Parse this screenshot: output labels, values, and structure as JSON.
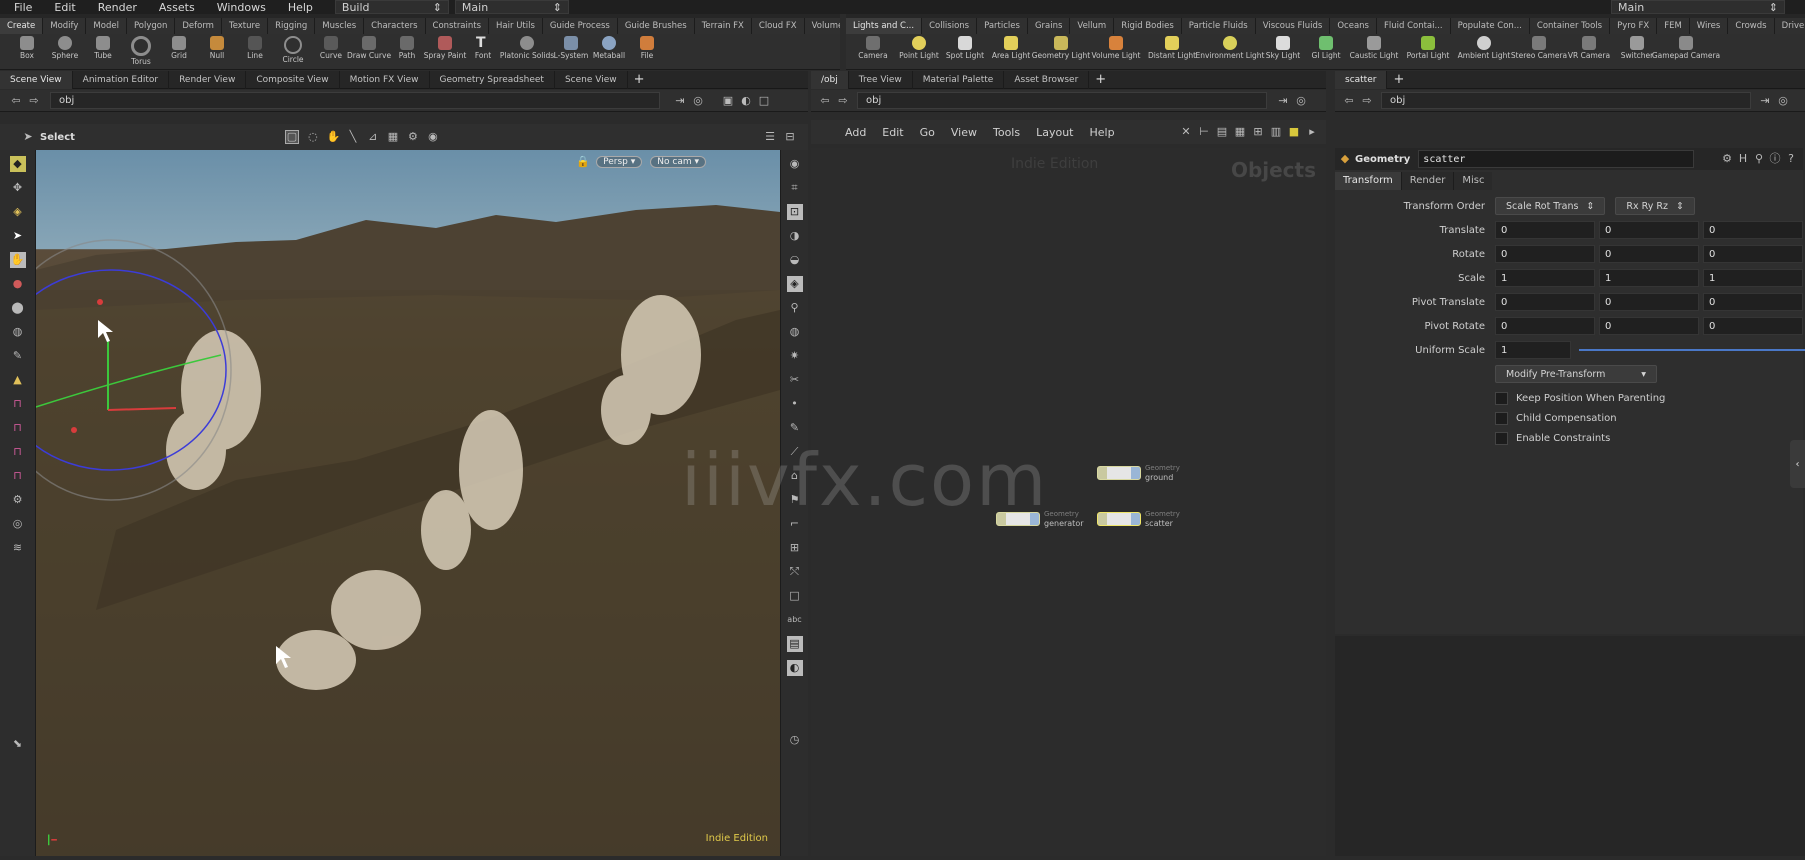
{
  "menubar": {
    "items": [
      "File",
      "Edit",
      "Render",
      "Assets",
      "Windows",
      "Help"
    ],
    "desktop": "Build",
    "context": "Main",
    "context_right": "Main"
  },
  "shelf_left": {
    "tabs": [
      "Create",
      "Modify",
      "Model",
      "Polygon",
      "Deform",
      "Texture",
      "Rigging",
      "Muscles",
      "Characters",
      "Constraints",
      "Hair Utils",
      "Guide Process",
      "Guide Brushes",
      "Terrain FX",
      "Cloud FX",
      "Volume"
    ],
    "tools": [
      "Box",
      "Sphere",
      "Tube",
      "Torus",
      "Grid",
      "Null",
      "Line",
      "Circle",
      "Curve",
      "Draw Curve",
      "Path",
      "Spray Paint",
      "Font",
      "Platonic Solids",
      "L-System",
      "Metaball",
      "File"
    ]
  },
  "shelf_right": {
    "tabs": [
      "Lights and C...",
      "Collisions",
      "Particles",
      "Grains",
      "Vellum",
      "Rigid Bodies",
      "Particle Fluids",
      "Viscous Fluids",
      "Oceans",
      "Fluid Contai...",
      "Populate Con...",
      "Container Tools",
      "Pyro FX",
      "FEM",
      "Wires",
      "Crowds",
      "Drive Simula..."
    ],
    "tools": [
      "Camera",
      "Point Light",
      "Spot Light",
      "Area Light",
      "Geometry Light",
      "Volume Light",
      "Distant Light",
      "Environment Light",
      "Sky Light",
      "GI Light",
      "Caustic Light",
      "Portal Light",
      "Ambient Light",
      "Stereo Camera",
      "VR Camera",
      "Switcher",
      "Gamepad Camera"
    ]
  },
  "viewer": {
    "tabs": [
      "Scene View",
      "Animation Editor",
      "Render View",
      "Composite View",
      "Motion FX View",
      "Geometry Spreadsheet",
      "Scene View"
    ],
    "path": "obj",
    "mode": "Select",
    "persp": "Persp",
    "cam": "No cam",
    "edition": "Indie Edition"
  },
  "network": {
    "tabs": [
      "/obj",
      "Tree View",
      "Material Palette",
      "Asset Browser"
    ],
    "path": "obj",
    "menu": [
      "Add",
      "Edit",
      "Go",
      "View",
      "Tools",
      "Layout",
      "Help"
    ],
    "watermark_edition": "Indie Edition",
    "context_label": "Objects",
    "overlay": "iiivfx.com",
    "nodes": [
      {
        "type": "Geometry",
        "name": "ground"
      },
      {
        "type": "Geometry",
        "name": "generator"
      },
      {
        "type": "Geometry",
        "name": "scatter"
      }
    ]
  },
  "params": {
    "tab": "scatter",
    "path": "obj",
    "node_type": "Geometry",
    "node_name": "scatter",
    "tabs": [
      "Transform",
      "Render",
      "Misc"
    ],
    "transform_order_label": "Transform Order",
    "transform_order": "Scale Rot Trans",
    "rot_order": "Rx Ry Rz",
    "rows": [
      {
        "label": "Translate",
        "values": [
          "0",
          "0",
          "0"
        ]
      },
      {
        "label": "Rotate",
        "values": [
          "0",
          "0",
          "0"
        ]
      },
      {
        "label": "Scale",
        "values": [
          "1",
          "1",
          "1"
        ]
      },
      {
        "label": "Pivot Translate",
        "values": [
          "0",
          "0",
          "0"
        ]
      },
      {
        "label": "Pivot Rotate",
        "values": [
          "0",
          "0",
          "0"
        ]
      }
    ],
    "uniform_scale_label": "Uniform Scale",
    "uniform_scale": "1",
    "modify_btn": "Modify Pre-Transform",
    "checks": [
      "Keep Position When Parenting",
      "Child Compensation",
      "Enable Constraints"
    ]
  }
}
